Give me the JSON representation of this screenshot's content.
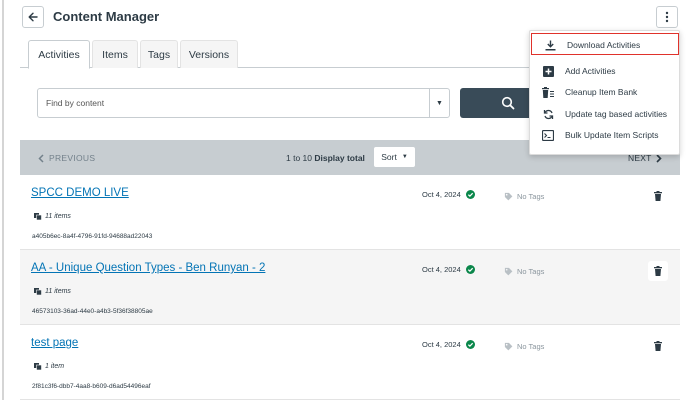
{
  "header": {
    "title": "Content Manager",
    "back_icon": "arrow-left-icon",
    "more_icon": "kebab-vertical-icon"
  },
  "tabs": [
    {
      "label": "Activities",
      "active": true
    },
    {
      "label": "Items",
      "active": false
    },
    {
      "label": "Tags",
      "active": false
    },
    {
      "label": "Versions",
      "active": false
    }
  ],
  "search": {
    "placeholder": "Find by content",
    "value": ""
  },
  "pagination": {
    "prev_label": "PREVIOUS",
    "range": "1 to 10",
    "display_total_label": "Display total",
    "sort_label": "Sort",
    "next_label": "NEXT"
  },
  "rows": [
    {
      "title": "SPCC DEMO LIVE",
      "count": "11 items",
      "id": "a405b6ec-8a4f-4796-91fd-94688ad22043",
      "date": "Oct 4, 2024",
      "tags": "No Tags"
    },
    {
      "title": "AA - Unique Question Types - Ben Runyan - 2",
      "count": "11 items",
      "id": "46573103-36ad-44e0-a4b3-5f36f38805ae",
      "date": "Oct 4, 2024",
      "tags": "No Tags"
    },
    {
      "title": "test page",
      "count": "1 item",
      "id": "2f81c3f6-dbb7-4aa8-b609-d6ad54496eaf",
      "date": "Oct 4, 2024",
      "tags": "No Tags"
    }
  ],
  "menu": {
    "items": [
      {
        "label": "Download Activities",
        "icon": "download-icon",
        "highlighted": true
      },
      {
        "label": "Add Activities",
        "icon": "add-square-icon",
        "highlighted": false
      },
      {
        "label": "Cleanup Item Bank",
        "icon": "trash-list-icon",
        "highlighted": false
      },
      {
        "label": "Update tag based activities",
        "icon": "refresh-icon",
        "highlighted": false
      },
      {
        "label": "Bulk Update Item Scripts",
        "icon": "terminal-icon",
        "highlighted": false
      }
    ]
  },
  "colors": {
    "link": "#0374b5",
    "success": "#0b874b",
    "search_button": "#394b58",
    "pager_bg": "#c7cdd1",
    "highlight_border": "#e0322b"
  }
}
